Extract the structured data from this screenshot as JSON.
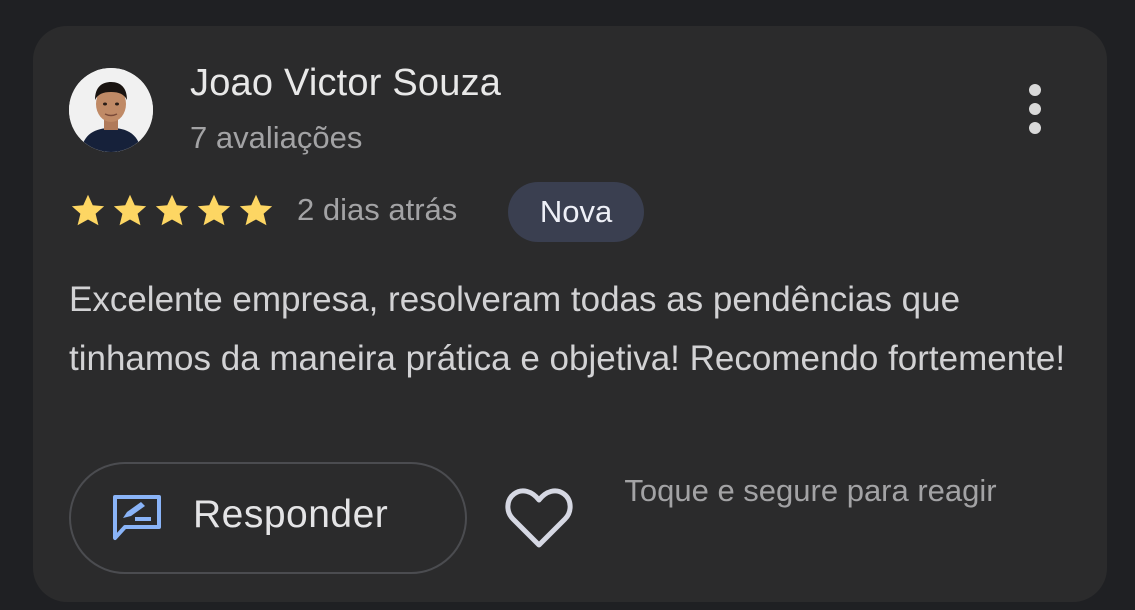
{
  "review": {
    "reviewer_name": "Joao Victor Souza",
    "review_count": "7 avaliações",
    "rating": 5,
    "rating_max": 5,
    "date": "2 dias atrás",
    "badge": "Nova",
    "text": "Excelente empresa, resolveram todas as pendências que tinhamos da maneira prática e objetiva! Recomendo fortemente!"
  },
  "actions": {
    "reply_label": "Responder",
    "reply_icon": "reply-icon",
    "like_icon": "heart-icon",
    "more_icon": "more-vertical-icon",
    "react_hint": "Toque e segure para reagir"
  },
  "colors": {
    "card_background": "#2b2b2c",
    "page_background": "#1f2023",
    "star": "#fdd663",
    "badge_background": "#3a3f50",
    "reply_icon": "#8ab4f8"
  }
}
